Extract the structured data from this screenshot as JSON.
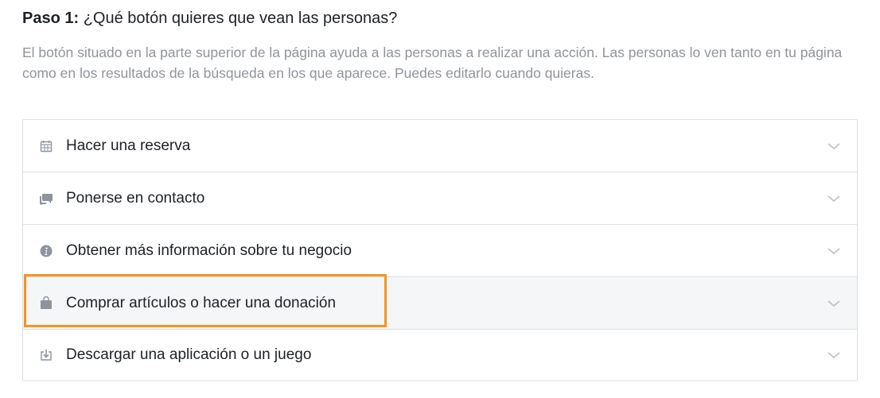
{
  "step": {
    "label": "Paso 1:",
    "question": "¿Qué botón quieres que vean las personas?",
    "description": "El botón situado en la parte superior de la página ayuda a las personas a realizar una acción. Las personas lo ven tanto en tu página como en los resultados de la búsqueda en los que aparece. Puedes editarlo cuando quieras."
  },
  "options": [
    {
      "label": "Hacer una reserva",
      "icon": "calendar-icon"
    },
    {
      "label": "Ponerse en contacto",
      "icon": "chat-bubbles-icon"
    },
    {
      "label": "Obtener más información sobre tu negocio",
      "icon": "info-icon"
    },
    {
      "label": "Comprar artículos o hacer una donación",
      "icon": "shopping-bag-icon",
      "highlighted": true
    },
    {
      "label": "Descargar una aplicación o un juego",
      "icon": "download-icon"
    }
  ],
  "colors": {
    "highlight": "#f7941d",
    "text": "#1d2129",
    "muted": "#90949c",
    "icon": "#8d949e"
  }
}
